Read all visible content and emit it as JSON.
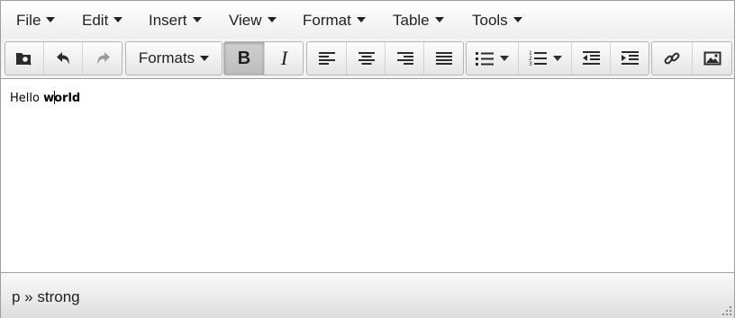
{
  "menubar": {
    "items": [
      {
        "label": "File"
      },
      {
        "label": "Edit"
      },
      {
        "label": "Insert"
      },
      {
        "label": "View"
      },
      {
        "label": "Format"
      },
      {
        "label": "Table"
      },
      {
        "label": "Tools"
      }
    ]
  },
  "toolbar": {
    "formats_label": "Formats",
    "buttons": {
      "find": {
        "icon": "find-replace-icon"
      },
      "undo": {
        "icon": "undo-icon"
      },
      "redo": {
        "icon": "redo-icon",
        "state": "disabled"
      },
      "bold": {
        "label": "B",
        "icon": "bold-icon",
        "state": "active"
      },
      "italic": {
        "label": "I",
        "icon": "italic-icon"
      },
      "align_left": {
        "icon": "align-left-icon"
      },
      "align_center": {
        "icon": "align-center-icon"
      },
      "align_right": {
        "icon": "align-right-icon"
      },
      "align_justify": {
        "icon": "align-justify-icon"
      },
      "bullet_list": {
        "icon": "bullet-list-icon"
      },
      "numbered_list": {
        "icon": "numbered-list-icon"
      },
      "outdent": {
        "icon": "outdent-icon"
      },
      "indent": {
        "icon": "indent-icon"
      },
      "link": {
        "icon": "link-icon"
      },
      "image": {
        "icon": "image-icon"
      }
    }
  },
  "content": {
    "text_plain": "Hello ",
    "text_bold_before_cursor": "w",
    "text_bold_after_cursor": "orld"
  },
  "statusbar": {
    "path": "p » strong"
  },
  "colors": {
    "border": "#9e9e9e",
    "active_button": "#c4c4c4",
    "disabled_icon": "#9a9a9a"
  }
}
